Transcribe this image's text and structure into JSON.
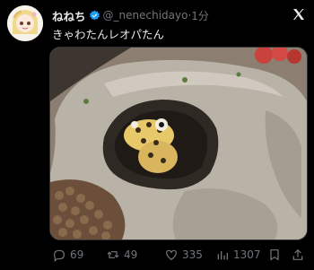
{
  "tweet": {
    "display_name": "ねねち",
    "handle": "@_nenechidayo",
    "separator": "·",
    "time": "1分",
    "text": "きゃわたんレオパたん"
  },
  "icons": {
    "avatar": "anime-avatar",
    "verified": "verified-badge-icon",
    "platform": "x-logo-icon"
  },
  "media": {
    "description_icon": "gecko-photo"
  },
  "actions": {
    "reply_count": "69",
    "retweet_count": "49",
    "like_count": "335",
    "view_count": "1307"
  },
  "colors": {
    "background": "#000000",
    "text": "#e7e9ea",
    "muted": "#71767b",
    "verified": "#1d9bf0"
  }
}
